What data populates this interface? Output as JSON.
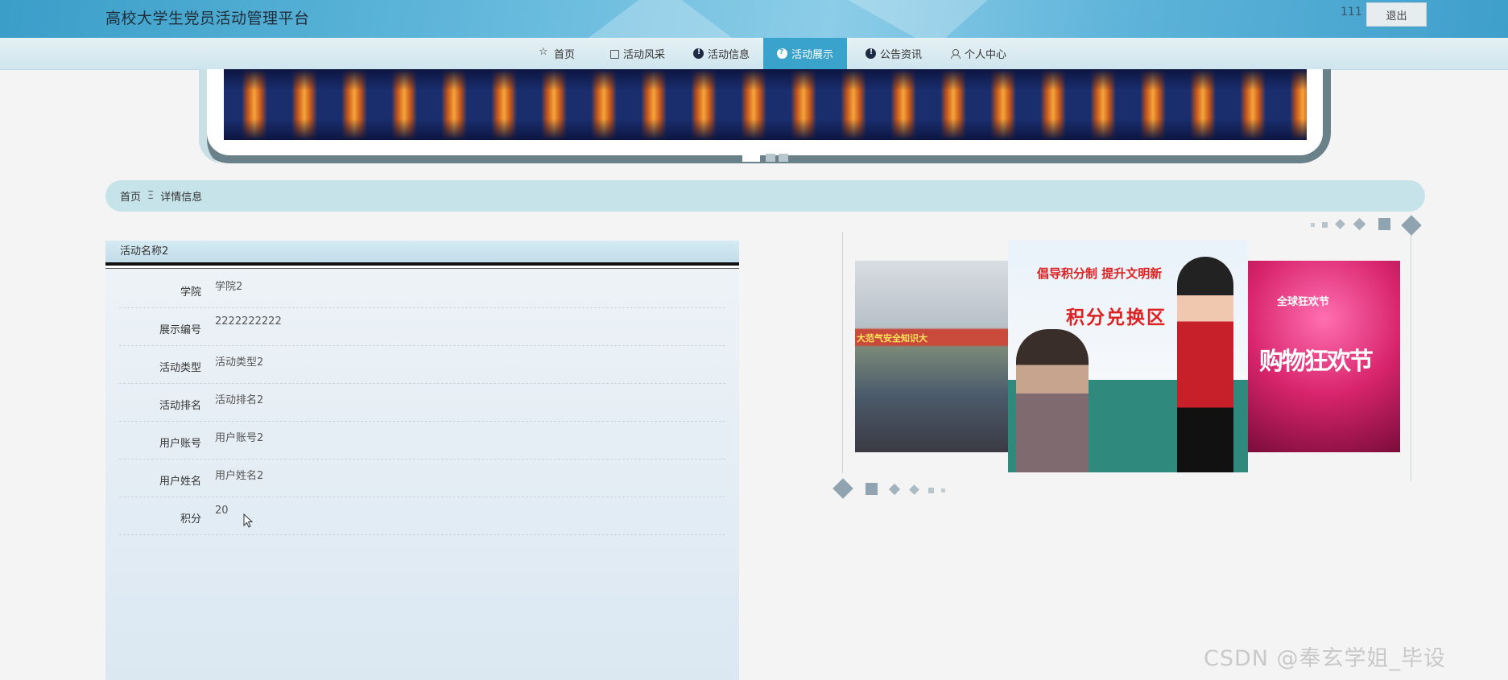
{
  "header": {
    "title": "高校大学生党员活动管理平台",
    "username": "111",
    "logout_label": "退出"
  },
  "nav": {
    "items": [
      {
        "label": "首页",
        "icon": "star-icon",
        "active": false
      },
      {
        "label": "活动风采",
        "icon": "bag-icon",
        "active": false
      },
      {
        "label": "活动信息",
        "icon": "info-icon",
        "active": false
      },
      {
        "label": "活动展示",
        "icon": "question-icon",
        "active": true
      },
      {
        "label": "公告资讯",
        "icon": "info-icon",
        "active": false
      },
      {
        "label": "个人中心",
        "icon": "user-icon",
        "active": false
      }
    ]
  },
  "breadcrumb": {
    "home": "首页",
    "separator": "Ξ",
    "current": "详情信息"
  },
  "detail": {
    "title": "活动名称2",
    "fields": [
      {
        "label": "学院",
        "value": "学院2"
      },
      {
        "label": "展示编号",
        "value": "2222222222"
      },
      {
        "label": "活动类型",
        "value": "活动类型2"
      },
      {
        "label": "活动排名",
        "value": "活动排名2"
      },
      {
        "label": "用户账号",
        "value": "用户账号2"
      },
      {
        "label": "用户姓名",
        "value": "用户姓名2"
      },
      {
        "label": "积分",
        "value": "20"
      }
    ]
  },
  "carousel": {
    "center_text_1": "倡导积分制  提升文明新",
    "center_text_2": "积分兑换区",
    "right_text_1": "全球狂欢节",
    "right_text_2": "购物狂欢节",
    "left_banner": "大范气安全知识大"
  },
  "watermark": "CSDN @奉玄学姐_毕设",
  "colors": {
    "accent": "#3aa3cc",
    "breadcrumb_bg": "#c6e3ea",
    "frame": "#6a8189"
  }
}
